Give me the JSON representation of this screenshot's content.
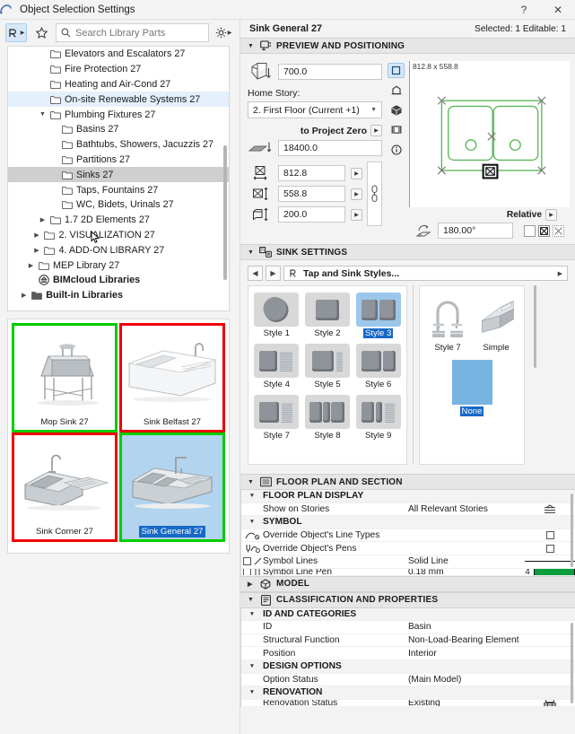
{
  "window": {
    "title": "Object Selection Settings",
    "help_label": "?",
    "close_label": "✕",
    "app_icon": "archicad-icon"
  },
  "library_toolbar": {
    "browse_button": "browse-library-icon",
    "favorites_button": "star-icon",
    "settings_button": "gear-icon",
    "search": {
      "placeholder": "Search Library Parts",
      "value": ""
    }
  },
  "tree": {
    "items": [
      {
        "label": "Elevators and Escalators 27",
        "indent": 2,
        "twisty": "",
        "state": ""
      },
      {
        "label": "Fire Protection 27",
        "indent": 2,
        "twisty": "",
        "state": ""
      },
      {
        "label": "Heating and Air-Cond 27",
        "indent": 2,
        "twisty": "",
        "state": ""
      },
      {
        "label": "On-site Renewable Systems 27",
        "indent": 2,
        "twisty": "",
        "state": "sel-light"
      },
      {
        "label": "Plumbing Fixtures 27",
        "indent": 2,
        "twisty": "▼",
        "state": ""
      },
      {
        "label": "Basins 27",
        "indent": 3,
        "twisty": "",
        "state": ""
      },
      {
        "label": "Bathtubs, Showers, Jacuzzis 27",
        "indent": 3,
        "twisty": "",
        "state": ""
      },
      {
        "label": "Partitions 27",
        "indent": 3,
        "twisty": "",
        "state": ""
      },
      {
        "label": "Sinks 27",
        "indent": 3,
        "twisty": "",
        "state": "sel-grey"
      },
      {
        "label": "Taps, Fountains 27",
        "indent": 3,
        "twisty": "",
        "state": ""
      },
      {
        "label": "WC, Bidets, Urinals 27",
        "indent": 3,
        "twisty": "",
        "state": ""
      },
      {
        "label": "1.7 2D Elements 27",
        "indent": 2,
        "twisty": "▶",
        "state": ""
      },
      {
        "label": "2. VISUALIZATION 27",
        "indent": 1.5,
        "twisty": "▶",
        "state": ""
      },
      {
        "label": "4. ADD-ON LIBRARY 27",
        "indent": 1.5,
        "twisty": "▶",
        "state": ""
      },
      {
        "label": "MEP Library 27",
        "indent": 1,
        "twisty": "▶",
        "state": ""
      },
      {
        "label": "BIMcloud Libraries",
        "indent": 1,
        "twisty": "",
        "state": "bold"
      },
      {
        "label": "Built-in Libraries",
        "indent": 0.4,
        "twisty": "▶",
        "state": "bold"
      }
    ]
  },
  "thumbnails": {
    "items": [
      {
        "label": "Mop Sink 27",
        "art": "mop-sink",
        "mark": "mark-green",
        "selected": false
      },
      {
        "label": "Sink Belfast 27",
        "art": "belfast-sink",
        "mark": "mark-red",
        "selected": false
      },
      {
        "label": "Sink Corner 27",
        "art": "corner-sink",
        "mark": "mark-red",
        "selected": false
      },
      {
        "label": "Sink General 27",
        "art": "general-sink",
        "mark": "mark-green",
        "selected": true
      }
    ]
  },
  "object_header": {
    "name": "Sink General 27",
    "selection_info": "Selected: 1 Editable: 1"
  },
  "preview_positioning": {
    "section_title": "PREVIEW AND POSITIONING",
    "elevation_value": "700.0",
    "home_story_label": "Home Story:",
    "home_story_value": "2. First Floor (Current +1)",
    "to_project_zero_label": "to Project Zero",
    "project_zero_value": "18400.0",
    "width_value": "812.8",
    "depth_value": "558.8",
    "height_value": "200.0",
    "canvas_dims": "812.8 x 558.8",
    "relative_label": "Relative",
    "angle_value": "180.00°"
  },
  "sink_settings": {
    "section_title": "SINK SETTINGS",
    "nav_label": "Tap and Sink Styles...",
    "prev_label": "◀",
    "next_label": "▶",
    "styles": [
      {
        "label": "Style 1",
        "art": "round-bowl",
        "selected": false
      },
      {
        "label": "Style 2",
        "art": "single-bowl",
        "selected": false
      },
      {
        "label": "Style 3",
        "art": "double-bowl",
        "selected": true
      },
      {
        "label": "Style 4",
        "art": "bowl-drainer-l",
        "selected": false
      },
      {
        "label": "Style 5",
        "art": "bowl-narrow-drain",
        "selected": false
      },
      {
        "label": "Style 6",
        "art": "bowl-half-bowl",
        "selected": false
      },
      {
        "label": "Style 7",
        "art": "bowl-drainer-r",
        "selected": false
      },
      {
        "label": "Style 8",
        "art": "triple-bowl",
        "selected": false
      },
      {
        "label": "Style 9",
        "art": "bowl-slim-drainer",
        "selected": false
      }
    ],
    "taps": [
      {
        "label": "Style 7",
        "art": "bridge-tap",
        "selected": false
      },
      {
        "label": "Simple",
        "art": "simple-tap",
        "selected": false
      },
      {
        "label": "None",
        "art": "none-swatch",
        "selected": true
      }
    ]
  },
  "floor_plan_section": {
    "section_title": "FLOOR PLAN AND SECTION",
    "groups": [
      {
        "title": "FLOOR PLAN DISPLAY",
        "rows": [
          {
            "name": "Show on Stories",
            "value": "All Relevant Stories",
            "control": "stories-icon",
            "icon": ""
          }
        ]
      },
      {
        "title": "SYMBOL",
        "rows": [
          {
            "name": "Override Object's Line Types",
            "value": "",
            "control": "checkbox",
            "icon": "line-type-icon"
          },
          {
            "name": "Override Object's Pens",
            "value": "",
            "control": "checkbox",
            "icon": "pen-icon"
          },
          {
            "name": "Symbol Lines",
            "value": "Solid Line",
            "control": "solid-line",
            "icon": "checkbox-line-icon"
          },
          {
            "name": "Symbol Line Pen",
            "value": "0.18 mm",
            "control": "pen-swatch",
            "icon": "checkbox-pen-icon",
            "pen_number": "4"
          }
        ]
      }
    ]
  },
  "model_section": {
    "section_title": "MODEL"
  },
  "classification_section": {
    "section_title": "CLASSIFICATION AND PROPERTIES",
    "groups": [
      {
        "title": "ID AND CATEGORIES",
        "rows": [
          {
            "name": "ID",
            "value": "Basin",
            "control": ""
          },
          {
            "name": "Structural Function",
            "value": "Non-Load-Bearing Element",
            "control": ""
          },
          {
            "name": "Position",
            "value": "Interior",
            "control": ""
          }
        ]
      },
      {
        "title": "DESIGN OPTIONS",
        "rows": [
          {
            "name": "Option Status",
            "value": "(Main Model)",
            "control": ""
          }
        ]
      },
      {
        "title": "RENOVATION",
        "rows": [
          {
            "name": "Renovation Status",
            "value": "Existing",
            "control": "renovation-icon"
          }
        ]
      }
    ]
  },
  "colors": {
    "accent": "#1669c7",
    "selection_light": "#e4f0fb",
    "selection_grey": "#cfcfcf",
    "mark_green": "#00cc00",
    "mark_red": "#ee0000",
    "preview_green": "#4caf50"
  }
}
